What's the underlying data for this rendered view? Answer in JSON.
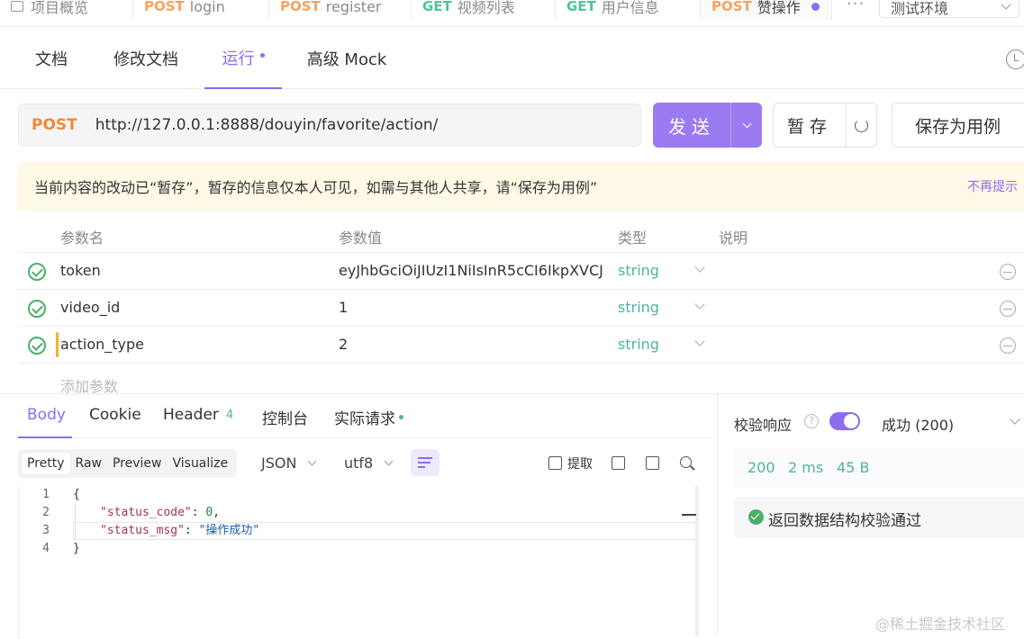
{
  "top_tabs": [
    {
      "method": "",
      "label": "项目概览"
    },
    {
      "method": "POST",
      "label": "login"
    },
    {
      "method": "POST",
      "label": "register"
    },
    {
      "method": "GET",
      "label": "视频列表"
    },
    {
      "method": "GET",
      "label": "用户信息"
    },
    {
      "method": "POST",
      "label": "赞操作"
    }
  ],
  "more_label": "···",
  "environment": "测试环境",
  "sub_tabs": [
    "文档",
    "修改文档",
    "运行",
    "高级 Mock"
  ],
  "request": {
    "method": "POST",
    "url": "http://127.0.0.1:8888/douyin/favorite/action/",
    "send_label": "发送",
    "stash_label": "暂存",
    "save_as_label": "保存为用例"
  },
  "notice": {
    "message": "当前内容的改动已“暂存”，暂存的信息仅本人可见，如需与其他人共享，请“保存为用例”",
    "dismiss": "不再提示"
  },
  "params": {
    "headers": [
      "参数名",
      "参数值",
      "类型",
      "说明"
    ],
    "rows": [
      {
        "name": "token",
        "value": "eyJhbGciOiJIUzI1NiIsInR5cCI6IkpXVCJ",
        "type": "string"
      },
      {
        "name": "video_id",
        "value": "1",
        "type": "string"
      },
      {
        "name": "action_type",
        "value": "2",
        "type": "string"
      }
    ],
    "add_placeholder": "添加参数"
  },
  "response": {
    "tabs": {
      "body": "Body",
      "cookie": "Cookie",
      "header": "Header",
      "header_count": "4",
      "console": "控制台",
      "actual": "实际请求"
    },
    "view_modes": [
      "Pretty",
      "Raw",
      "Preview",
      "Visualize"
    ],
    "format": "JSON",
    "encoding": "utf8",
    "extract_label": "提取",
    "code_lines": [
      {
        "n": "1"
      },
      {
        "n": "2",
        "key": "\"status_code\"",
        "val": "0"
      },
      {
        "n": "3",
        "key": "\"status_msg\"",
        "val": "\"操作成功\""
      },
      {
        "n": "4"
      }
    ],
    "code": {
      "open": "{",
      "close": "}",
      "colon": ": ",
      "comma": ","
    }
  },
  "validation": {
    "label": "校验响应",
    "result": "成功 (200)",
    "status": "200",
    "time": "2 ms",
    "size": "45 B",
    "message": "返回数据结构校验通过"
  },
  "watermark": "@稀土掘金技术社区",
  "colors": {
    "accent": "#8d6cf0",
    "post": "#f5a35c",
    "get": "#4fc3a0",
    "success": "#4caf6a"
  }
}
